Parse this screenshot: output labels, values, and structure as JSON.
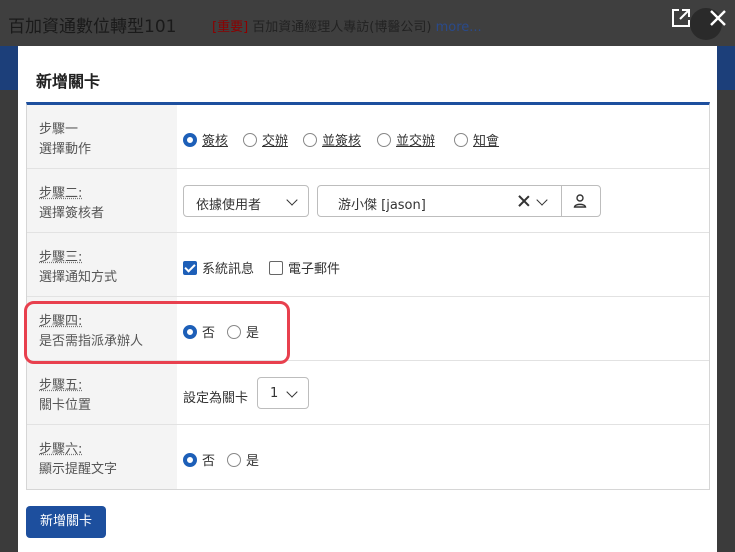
{
  "background": {
    "title": "百加資通數位轉型101",
    "news_tag": "[重要]",
    "news_text": " 百加資通經理人專訪(博醫公司) ",
    "news_more": "more..."
  },
  "modal": {
    "title": "新增關卡",
    "submit_label": "新增關卡"
  },
  "steps": [
    {
      "step": "步驟一",
      "desc": "選擇動作",
      "options": [
        "簽核",
        "交辦",
        "並簽核",
        "並交辦",
        "知會"
      ],
      "selected": "簽核"
    },
    {
      "step": "步驟二:",
      "desc": "選擇簽核者",
      "mode_select": "依據使用者",
      "user_select": "游小傑 [jason]"
    },
    {
      "step": "步驟三:",
      "desc": "選擇通知方式",
      "checks": [
        {
          "label": "系統訊息",
          "checked": true
        },
        {
          "label": "電子郵件",
          "checked": false
        }
      ]
    },
    {
      "step": "步驟四:",
      "desc": "是否需指派承辦人",
      "options": [
        "否",
        "是"
      ],
      "selected": "否"
    },
    {
      "step": "步驟五:",
      "desc": "關卡位置",
      "prefix": "設定為關卡",
      "position_select": "1"
    },
    {
      "step": "步驟六:",
      "desc": "顯示提醒文字",
      "options": [
        "否",
        "是"
      ],
      "selected": "否"
    }
  ],
  "colors": {
    "accent": "#1d4f9e",
    "highlight": "#e8404e"
  },
  "icons": [
    "external-link-icon",
    "close-icon",
    "user-icon",
    "clear-icon",
    "chevron-down-icon"
  ]
}
